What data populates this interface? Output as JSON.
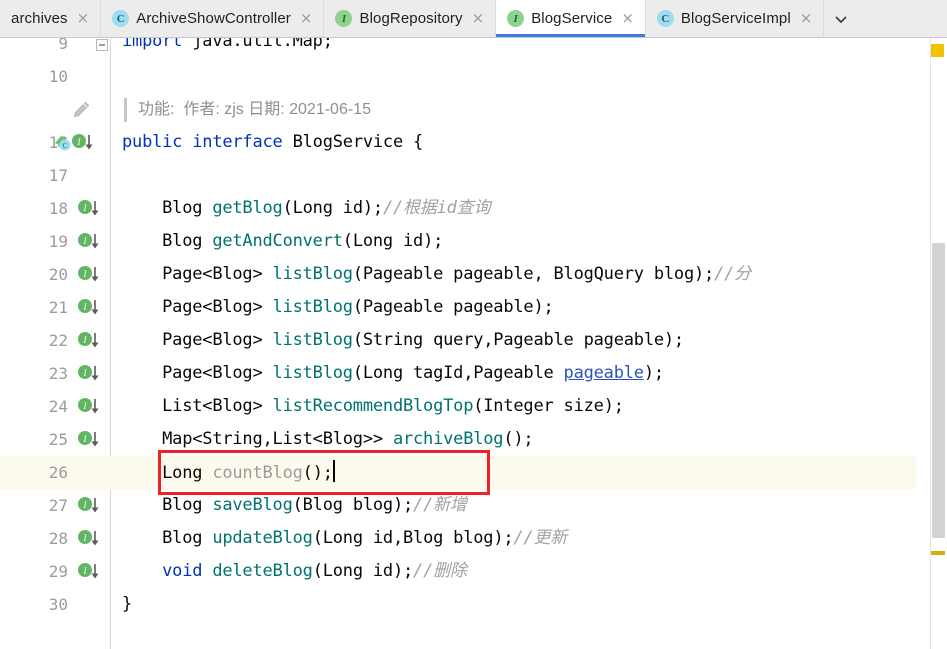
{
  "window": {
    "app": "IntelliJ IDEA Editor",
    "file": "BlogService.java"
  },
  "tabs": {
    "overflow_label": "∨",
    "items": [
      {
        "label": "archives",
        "icon": "none",
        "icon_letter": "",
        "active": false,
        "close_label": "×"
      },
      {
        "label": "ArchiveShowController",
        "icon": "class-icon",
        "icon_letter": "C",
        "active": false,
        "close_label": "×"
      },
      {
        "label": "BlogRepository",
        "icon": "interface-icon",
        "icon_letter": "I",
        "active": false,
        "close_label": "×"
      },
      {
        "label": "BlogService",
        "icon": "interface-icon",
        "icon_letter": "I",
        "active": true,
        "close_label": "×"
      },
      {
        "label": "BlogServiceImpl",
        "icon": "class-icon",
        "icon_letter": "C",
        "active": false,
        "close_label": "×"
      }
    ]
  },
  "folded_comment": {
    "text": "功能:  作者: zjs 日期: 2021-06-15"
  },
  "editor": {
    "current_line": 26,
    "lines": [
      {
        "number": "9",
        "marker": "none",
        "fold": "collapse",
        "partial": true,
        "tokens": [
          {
            "t": "import ",
            "c": "kw"
          },
          {
            "t": "java.util.Map;",
            "c": "plain"
          }
        ]
      },
      {
        "number": "10",
        "marker": "none",
        "tokens": []
      },
      {
        "number": "",
        "marker": "pencil",
        "fold_comment": true,
        "tokens": []
      },
      {
        "number": "16",
        "marker": "implemented-and-interface",
        "tokens": [
          {
            "t": "public ",
            "c": "kw"
          },
          {
            "t": "interface ",
            "c": "kw"
          },
          {
            "t": "BlogService {",
            "c": "plain"
          }
        ]
      },
      {
        "number": "17",
        "marker": "none",
        "tokens": []
      },
      {
        "number": "18",
        "marker": "interface-down",
        "tokens": [
          {
            "t": "    Blog ",
            "c": "plain"
          },
          {
            "t": "getBlog",
            "c": "meth"
          },
          {
            "t": "(Long id);",
            "c": "plain"
          },
          {
            "t": "//根据id查询",
            "c": "cmt"
          }
        ]
      },
      {
        "number": "19",
        "marker": "interface-down",
        "tokens": [
          {
            "t": "    Blog ",
            "c": "plain"
          },
          {
            "t": "getAndConvert",
            "c": "meth"
          },
          {
            "t": "(Long id);",
            "c": "plain"
          }
        ]
      },
      {
        "number": "20",
        "marker": "interface-down",
        "tokens": [
          {
            "t": "    Page<Blog> ",
            "c": "plain"
          },
          {
            "t": "listBlog",
            "c": "meth"
          },
          {
            "t": "(Pageable pageable, BlogQuery blog);",
            "c": "plain"
          },
          {
            "t": "//分",
            "c": "cmt"
          }
        ]
      },
      {
        "number": "21",
        "marker": "interface-down",
        "tokens": [
          {
            "t": "    Page<Blog> ",
            "c": "plain"
          },
          {
            "t": "listBlog",
            "c": "meth"
          },
          {
            "t": "(Pageable pageable);",
            "c": "plain"
          }
        ]
      },
      {
        "number": "22",
        "marker": "interface-down",
        "tokens": [
          {
            "t": "    Page<Blog> ",
            "c": "plain"
          },
          {
            "t": "listBlog",
            "c": "meth"
          },
          {
            "t": "(String query,Pageable pageable);",
            "c": "plain"
          }
        ]
      },
      {
        "number": "23",
        "marker": "interface-down",
        "tokens": [
          {
            "t": "    Page<Blog> ",
            "c": "plain"
          },
          {
            "t": "listBlog",
            "c": "meth"
          },
          {
            "t": "(Long tagId,Pageable ",
            "c": "plain"
          },
          {
            "t": "pageable",
            "c": "link"
          },
          {
            "t": ");",
            "c": "plain"
          }
        ]
      },
      {
        "number": "24",
        "marker": "interface-down",
        "tokens": [
          {
            "t": "    List<Blog> ",
            "c": "plain"
          },
          {
            "t": "listRecommendBlogTop",
            "c": "meth"
          },
          {
            "t": "(Integer size);",
            "c": "plain"
          }
        ]
      },
      {
        "number": "25",
        "marker": "interface-down",
        "tokens": [
          {
            "t": "    Map<String,List<Blog>> ",
            "c": "plain"
          },
          {
            "t": "archiveBlog",
            "c": "meth"
          },
          {
            "t": "();",
            "c": "plain"
          }
        ]
      },
      {
        "number": "26",
        "marker": "none",
        "current": true,
        "caret": true,
        "tokens": [
          {
            "t": "    Long ",
            "c": "plain"
          },
          {
            "t": "countBlog",
            "c": "methd"
          },
          {
            "t": "();",
            "c": "plain"
          }
        ]
      },
      {
        "number": "27",
        "marker": "interface-down",
        "tokens": [
          {
            "t": "    Blog ",
            "c": "plain"
          },
          {
            "t": "saveBlog",
            "c": "meth"
          },
          {
            "t": "(Blog blog);",
            "c": "plain"
          },
          {
            "t": "//新增",
            "c": "cmt"
          }
        ]
      },
      {
        "number": "28",
        "marker": "interface-down",
        "tokens": [
          {
            "t": "    Blog ",
            "c": "plain"
          },
          {
            "t": "updateBlog",
            "c": "meth"
          },
          {
            "t": "(Long id,Blog blog);",
            "c": "plain"
          },
          {
            "t": "//更新",
            "c": "cmt"
          }
        ]
      },
      {
        "number": "29",
        "marker": "interface-down",
        "tokens": [
          {
            "t": "    void ",
            "c": "kw"
          },
          {
            "t": "deleteBlog",
            "c": "meth"
          },
          {
            "t": "(Long id);",
            "c": "plain"
          },
          {
            "t": "//删除",
            "c": "cmt"
          }
        ]
      },
      {
        "number": "30",
        "marker": "none",
        "tokens": [
          {
            "t": "}",
            "c": "plain"
          }
        ]
      }
    ]
  },
  "annotation": {
    "shape": "rectangle",
    "color": "#ee2222",
    "target_line": 26,
    "target_text": "Long countBlog();"
  },
  "markers_strip": {
    "warning_square_color": "#f2c200",
    "warning_dash_color": "#d4b106"
  },
  "colors": {
    "keyword": "#0033b3",
    "method": "#00726e",
    "comment": "#a1a1a1",
    "active_tab_underline": "#3b7ddd",
    "current_line_bg": "#fcfaed",
    "annotation": "#ee2222"
  }
}
